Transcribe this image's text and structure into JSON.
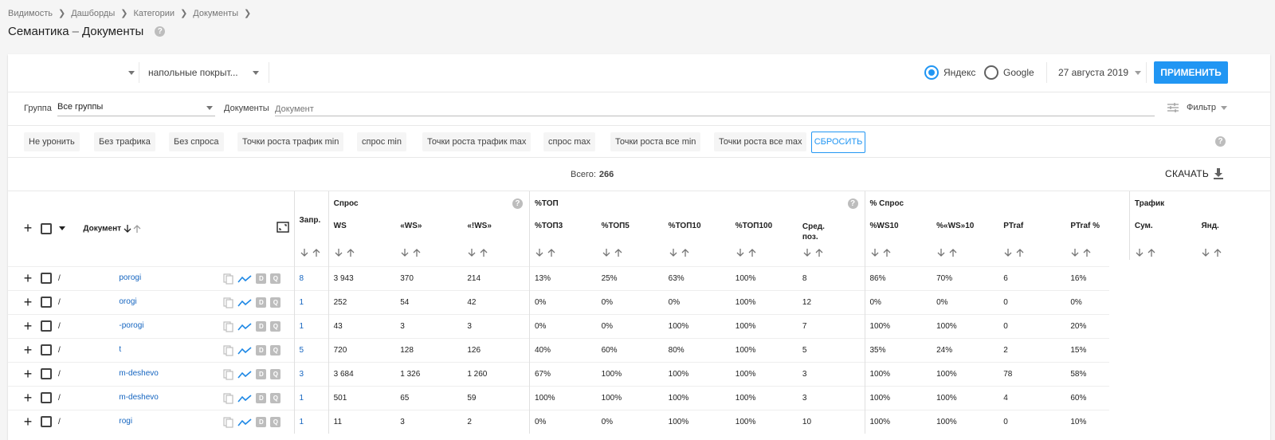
{
  "breadcrumbs": [
    "Видимость",
    "Дашборды",
    "Категории",
    "Документы"
  ],
  "title": {
    "main": "Семантика",
    "separator": "–",
    "sub": "Документы"
  },
  "help_glyph": "?",
  "toolbar": {
    "category_select": "напольные покрыт...",
    "engines": [
      {
        "label": "Яндекс",
        "selected": true
      },
      {
        "label": "Google",
        "selected": false
      }
    ],
    "date": "27 августа 2019",
    "apply_label": "ПРИМЕНИТЬ"
  },
  "filters": {
    "group_label": "Группа",
    "group_value": "Все группы",
    "documents_label": "Документы",
    "documents_placeholder": "Документ",
    "filter_label": "Фильтр"
  },
  "quick_filters": [
    "Не уронить",
    "Без трафика",
    "Без спроса",
    "Точки роста трафик min",
    "спрос min",
    "Точки роста трафик max",
    "спрос max",
    "Точки роста все min",
    "Точки роста все max"
  ],
  "reset_label": "СБРОСИТЬ",
  "summary": {
    "total_label": "Всего:",
    "total_value": "266",
    "download_label": "СКАЧАТЬ"
  },
  "table": {
    "document_header": "Документ",
    "requests_header": "Запр.",
    "groups": {
      "demand": "Спрос",
      "top": "%ТОП",
      "demand_pct": "% Спрос",
      "traffic": "Трафик"
    },
    "columns": [
      "WS",
      "«WS»",
      "«!WS»",
      "%ТОП3",
      "%ТОП5",
      "%ТОП10",
      "%ТОП100",
      "Сред. поз.",
      "%WS10",
      "%«WS»10",
      "PTraf",
      "PTraf %",
      "Сум.",
      "Янд."
    ],
    "avg_pos_line1": "Сред.",
    "avg_pos_line2": "поз.",
    "rows": [
      {
        "slash": "/",
        "doc": "porogi",
        "req": "8",
        "ws": "3 943",
        "qws": "370",
        "ews": "214",
        "t3": "13%",
        "t5": "25%",
        "t10": "63%",
        "t100": "100%",
        "avg": "8",
        "ws10": "86%",
        "qws10": "70%",
        "ptraf": "6",
        "ptrafp": "16%"
      },
      {
        "slash": "/",
        "doc": "orogi",
        "req": "1",
        "ws": "252",
        "qws": "54",
        "ews": "42",
        "t3": "0%",
        "t5": "0%",
        "t10": "0%",
        "t100": "100%",
        "avg": "12",
        "ws10": "0%",
        "qws10": "0%",
        "ptraf": "0",
        "ptrafp": "0%"
      },
      {
        "slash": "/",
        "doc": "-porogi",
        "req": "1",
        "ws": "43",
        "qws": "3",
        "ews": "3",
        "t3": "0%",
        "t5": "0%",
        "t10": "100%",
        "t100": "100%",
        "avg": "7",
        "ws10": "100%",
        "qws10": "100%",
        "ptraf": "0",
        "ptrafp": "20%"
      },
      {
        "slash": "/",
        "doc": "t",
        "req": "5",
        "ws": "720",
        "qws": "128",
        "ews": "126",
        "t3": "40%",
        "t5": "60%",
        "t10": "80%",
        "t100": "100%",
        "avg": "5",
        "ws10": "35%",
        "qws10": "24%",
        "ptraf": "2",
        "ptrafp": "15%"
      },
      {
        "slash": "/",
        "doc": "m-deshevo",
        "req": "3",
        "ws": "3 684",
        "qws": "1 326",
        "ews": "1 260",
        "t3": "67%",
        "t5": "100%",
        "t10": "100%",
        "t100": "100%",
        "avg": "3",
        "ws10": "100%",
        "qws10": "100%",
        "ptraf": "78",
        "ptrafp": "58%"
      },
      {
        "slash": "/",
        "doc": "m-deshevo",
        "req": "1",
        "ws": "501",
        "qws": "65",
        "ews": "59",
        "t3": "100%",
        "t5": "100%",
        "t10": "100%",
        "t100": "100%",
        "avg": "3",
        "ws10": "100%",
        "qws10": "100%",
        "ptraf": "4",
        "ptrafp": "60%"
      },
      {
        "slash": "/",
        "doc": "rogi",
        "req": "1",
        "ws": "11",
        "qws": "3",
        "ews": "2",
        "t3": "0%",
        "t5": "0%",
        "t10": "100%",
        "t100": "100%",
        "avg": "10",
        "ws10": "100%",
        "qws10": "100%",
        "ptraf": "0",
        "ptrafp": "10%"
      }
    ]
  },
  "row_badges": {
    "d": "D",
    "q": "Q"
  },
  "colors": {
    "accent": "#2196f3",
    "link": "#1565c0",
    "text": "#212121"
  }
}
